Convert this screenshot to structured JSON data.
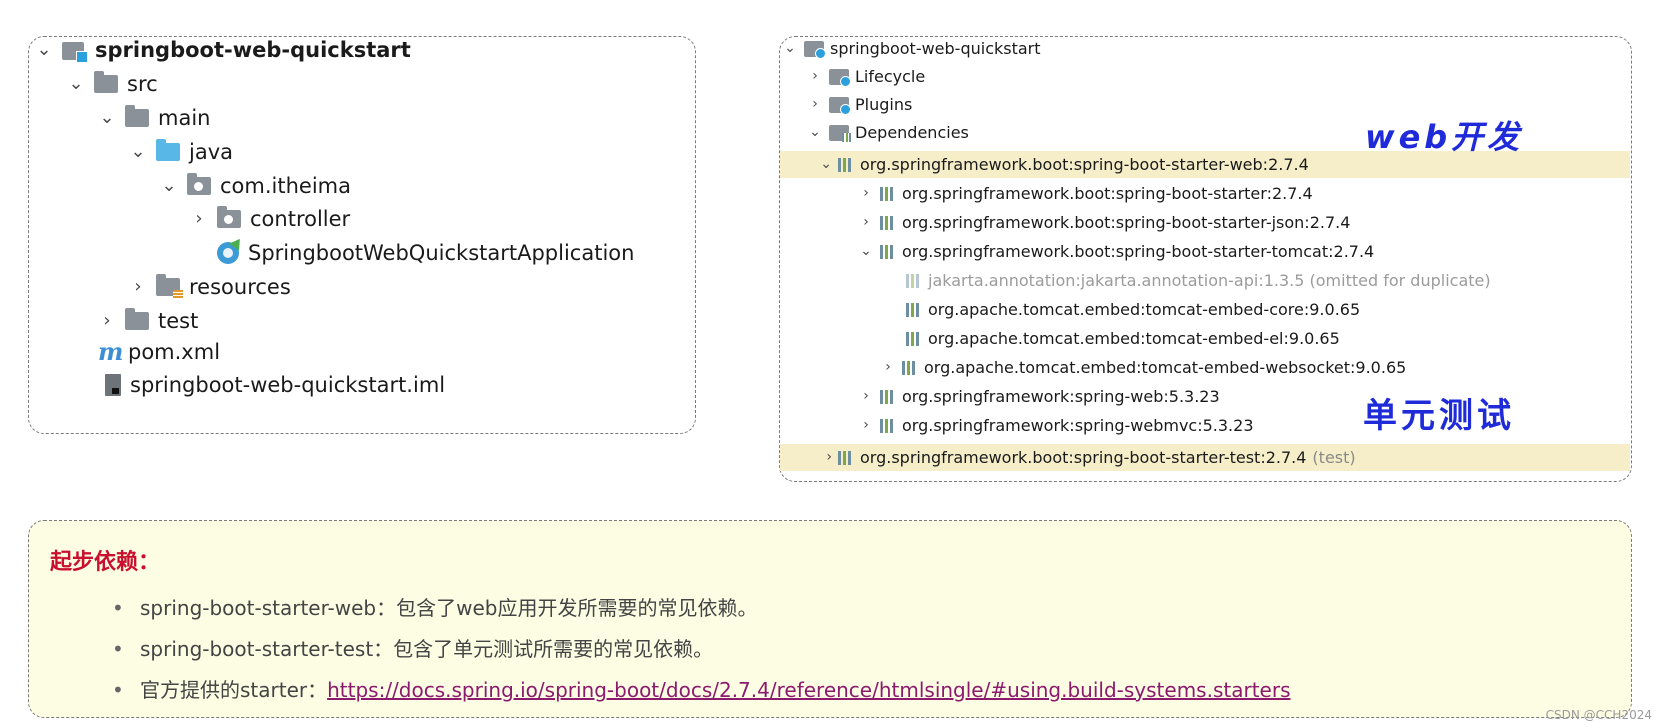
{
  "project_tree": {
    "root": "springboot-web-quickstart",
    "src": "src",
    "main": "main",
    "java": "java",
    "package": "com.itheima",
    "controller": "controller",
    "app_class": "SpringbootWebQuickstartApplication",
    "resources": "resources",
    "test": "test",
    "pom": "pom.xml",
    "iml": "springboot-web-quickstart.iml"
  },
  "maven_tree": {
    "root": "springboot-web-quickstart",
    "lifecycle": "Lifecycle",
    "plugins": "Plugins",
    "dependencies": "Dependencies",
    "deps": [
      {
        "name": "org.springframework.boot:spring-boot-starter-web:2.7.4",
        "scope": ""
      },
      {
        "name": "org.springframework.boot:spring-boot-starter:2.7.4",
        "scope": ""
      },
      {
        "name": "org.springframework.boot:spring-boot-starter-json:2.7.4",
        "scope": ""
      },
      {
        "name": "org.springframework.boot:spring-boot-starter-tomcat:2.7.4",
        "scope": ""
      },
      {
        "name": "jakarta.annotation:jakarta.annotation-api:1.3.5 (omitted for duplicate)",
        "scope": ""
      },
      {
        "name": "org.apache.tomcat.embed:tomcat-embed-core:9.0.65",
        "scope": ""
      },
      {
        "name": "org.apache.tomcat.embed:tomcat-embed-el:9.0.65",
        "scope": ""
      },
      {
        "name": "org.apache.tomcat.embed:tomcat-embed-websocket:9.0.65",
        "scope": ""
      },
      {
        "name": "org.springframework:spring-web:5.3.23",
        "scope": ""
      },
      {
        "name": "org.springframework:spring-webmvc:5.3.23",
        "scope": ""
      },
      {
        "name": "org.springframework.boot:spring-boot-starter-test:2.7.4",
        "scope": "(test)"
      }
    ]
  },
  "annotations": {
    "web_dev": "web开发",
    "unit_test": "单元测试"
  },
  "notes": {
    "title": "起步依赖：",
    "items": [
      "spring-boot-starter-web：包含了web应用开发所需要的常见依赖。",
      "spring-boot-starter-test：包含了单元测试所需要的常见依赖。"
    ],
    "starter_prefix": "官方提供的starter：",
    "starter_link": "https://docs.spring.io/spring-boot/docs/2.7.4/reference/htmlsingle/#using.build-systems.starters",
    "bullet": "•"
  },
  "watermark": "CSDN @CCH2024",
  "colors": {
    "highlight_row": "#f6eec9",
    "note_background": "#fdfde4",
    "note_title": "#c8102e",
    "handwriting": "#1f2bd8",
    "link": "#8b1a6e"
  }
}
